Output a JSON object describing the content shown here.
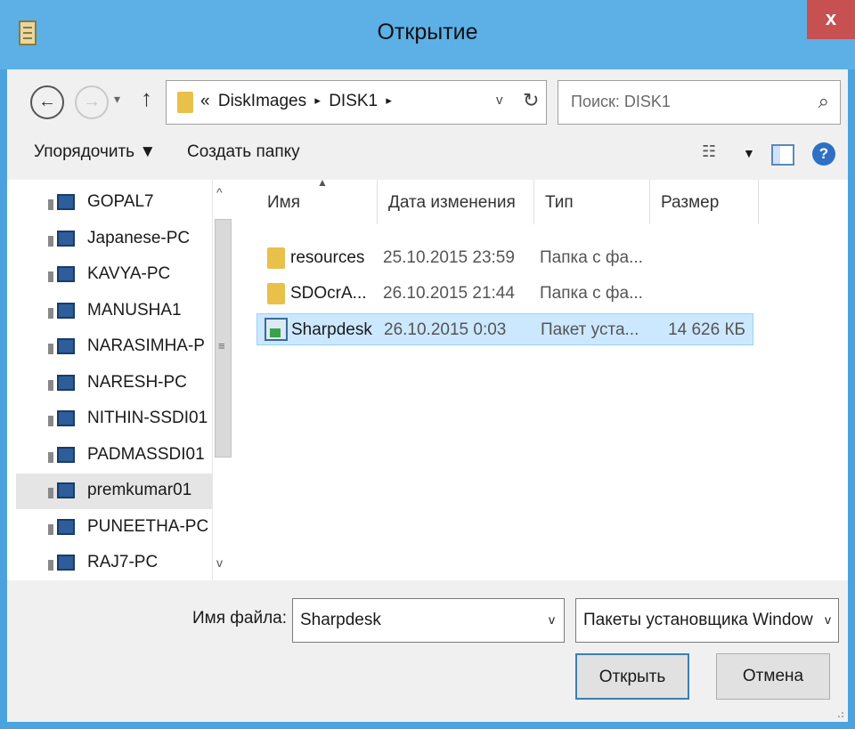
{
  "window": {
    "title": "Открытие",
    "close": "x",
    "title_bar_color": "#5cb0e6"
  },
  "nav": {
    "back_icon": "←",
    "forward_icon": "→",
    "recent_icon": "▾",
    "up_icon": "↑",
    "breadcrumbs": [
      "«",
      "DiskImages",
      "DISK1"
    ],
    "crumb_sep": "▸",
    "dropdown": "v",
    "refresh": "↻",
    "search_placeholder": "Поиск: DISK1",
    "search_icon": "⌕"
  },
  "toolbar": {
    "organize": "Упорядочить ▼",
    "new_folder": "Создать папку",
    "views_icon": "☷",
    "views_drop": "▼",
    "help": "?"
  },
  "sidebar": {
    "items": [
      {
        "label": "GOPAL7",
        "selected": false
      },
      {
        "label": "Japanese-PC",
        "selected": false
      },
      {
        "label": "KAVYA-PC",
        "selected": false
      },
      {
        "label": "MANUSHA1",
        "selected": false
      },
      {
        "label": "NARASIMHA-P",
        "selected": false
      },
      {
        "label": "NARESH-PC",
        "selected": false
      },
      {
        "label": "NITHIN-SSDI01",
        "selected": false
      },
      {
        "label": "PADMASSDI01",
        "selected": false
      },
      {
        "label": "premkumar01",
        "selected": true
      },
      {
        "label": "PUNEETHA-PC",
        "selected": false
      },
      {
        "label": "RAJ7-PC",
        "selected": false
      }
    ],
    "scroll_up": "^",
    "scroll_down": "v",
    "scroll_grip": "≡"
  },
  "columns": {
    "name": "Имя",
    "date": "Дата изменения",
    "type": "Тип",
    "size": "Размер",
    "sort_arrow": "▲"
  },
  "files": [
    {
      "name": "resources",
      "date": "25.10.2015 23:59",
      "type": "Папка с фа...",
      "size": "",
      "kind": "folder",
      "selected": false
    },
    {
      "name": "SDOcrA...",
      "date": "26.10.2015 21:44",
      "type": "Папка с фа...",
      "size": "",
      "kind": "folder",
      "selected": false
    },
    {
      "name": "Sharpdesk",
      "date": "26.10.2015 0:03",
      "type": "Пакет уста...",
      "size": "14 626 КБ",
      "kind": "package",
      "selected": true
    }
  ],
  "bottom": {
    "filename_label": "Имя файла:",
    "filename_value": "Sharpdesk",
    "filename_drop": "v",
    "filetype_value": "Пакеты установщика Window",
    "filetype_drop": "v",
    "open_button": "Открыть",
    "cancel_button": "Отмена"
  }
}
